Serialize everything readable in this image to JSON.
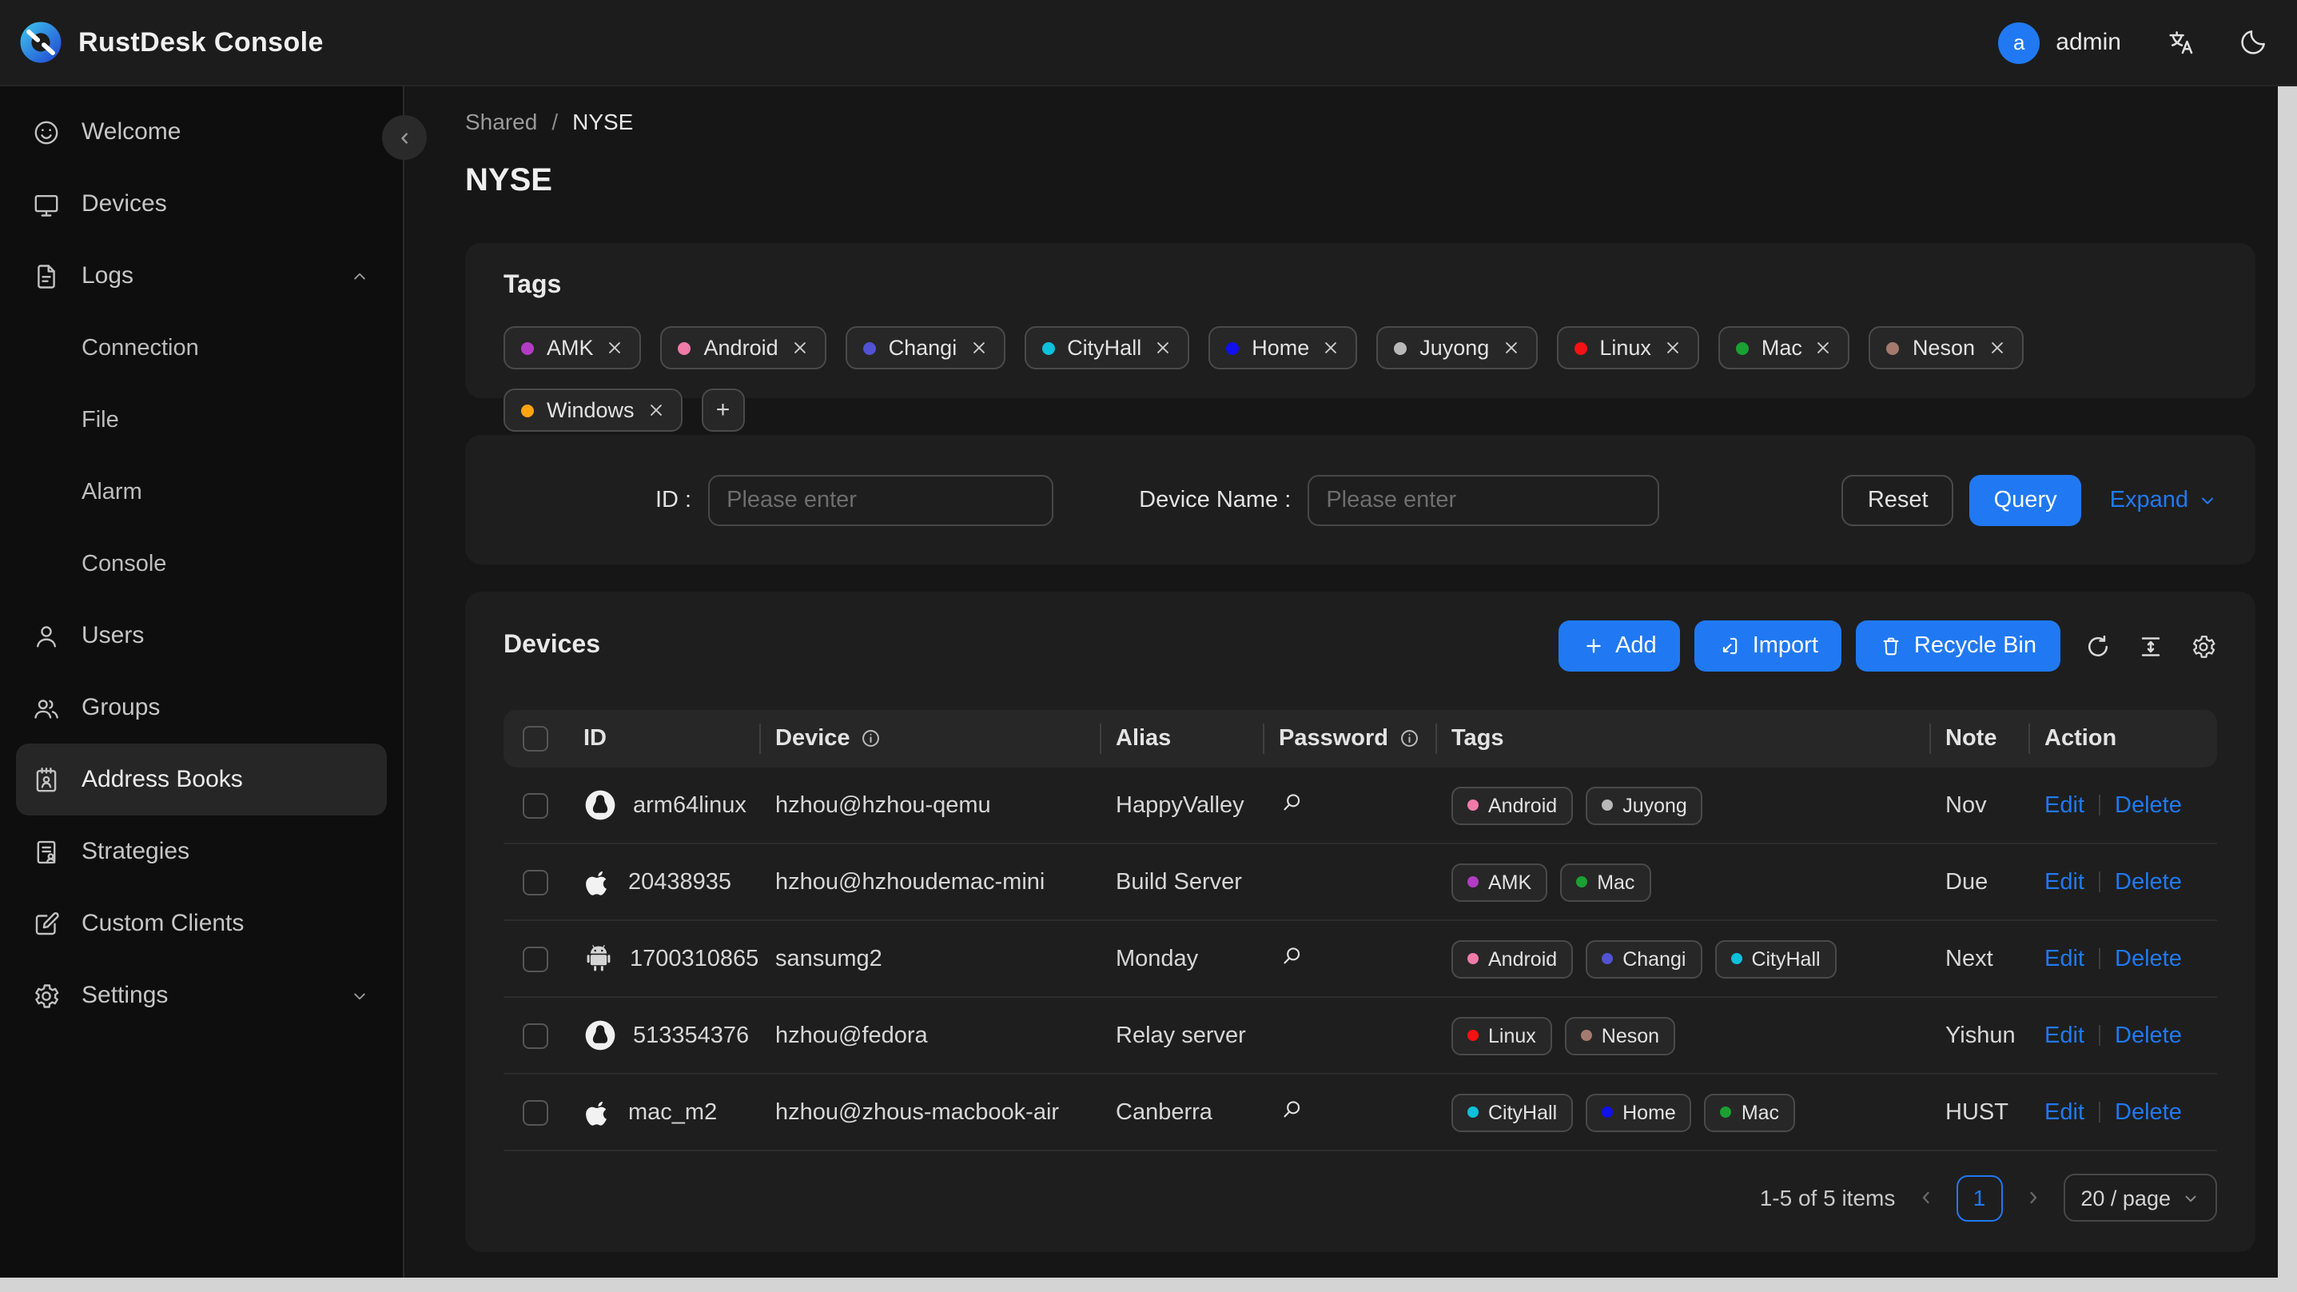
{
  "header": {
    "title": "RustDesk Console",
    "user": {
      "initial": "a",
      "name": "admin"
    }
  },
  "sidebar": {
    "items": [
      {
        "label": "Welcome",
        "icon": "smiley"
      },
      {
        "label": "Devices",
        "icon": "monitor"
      },
      {
        "label": "Logs",
        "icon": "document",
        "chevron": "up",
        "children": [
          "Connection",
          "File",
          "Alarm",
          "Console"
        ]
      },
      {
        "label": "Users",
        "icon": "user"
      },
      {
        "label": "Groups",
        "icon": "users"
      },
      {
        "label": "Address Books",
        "icon": "address-book",
        "active": true
      },
      {
        "label": "Strategies",
        "icon": "strategy"
      },
      {
        "label": "Custom Clients",
        "icon": "edit-square"
      },
      {
        "label": "Settings",
        "icon": "gear",
        "chevron": "down"
      }
    ]
  },
  "breadcrumb": {
    "parent": "Shared",
    "separator": "/",
    "current": "NYSE"
  },
  "page_title": "NYSE",
  "tags_card": {
    "title": "Tags",
    "add_button": "+",
    "tags": [
      {
        "label": "AMK",
        "color": "#b33cc4"
      },
      {
        "label": "Android",
        "color": "#f07ba8"
      },
      {
        "label": "Changi",
        "color": "#5153d4"
      },
      {
        "label": "CityHall",
        "color": "#0ec0da"
      },
      {
        "label": "Home",
        "color": "#1010f0"
      },
      {
        "label": "Juyong",
        "color": "#b8b8b8"
      },
      {
        "label": "Linux",
        "color": "#f51212"
      },
      {
        "label": "Mac",
        "color": "#1ba034"
      },
      {
        "label": "Neson",
        "color": "#a57a6e"
      },
      {
        "label": "Windows",
        "color": "#ffa313"
      }
    ]
  },
  "filter": {
    "id_label": "ID :",
    "id_placeholder": "Please enter",
    "device_name_label": "Device Name :",
    "device_name_placeholder": "Please enter",
    "reset_label": "Reset",
    "query_label": "Query",
    "expand_label": "Expand"
  },
  "devices_card": {
    "title": "Devices",
    "add_label": "Add",
    "import_label": "Import",
    "recycle_bin_label": "Recycle Bin",
    "table": {
      "columns": [
        "ID",
        "Device",
        "Alias",
        "Password",
        "Tags",
        "Note",
        "Action"
      ],
      "edit_label": "Edit",
      "delete_label": "Delete",
      "rows": [
        {
          "os": "linux",
          "id": "arm64linux",
          "device": "hzhou@hzhou-qemu",
          "alias": "HappyValley",
          "has_password": true,
          "tags": [
            "Android",
            "Juyong"
          ],
          "note": "Nov"
        },
        {
          "os": "apple",
          "id": "20438935",
          "device": "hzhou@hzhoudemac-mini",
          "alias": "Build Server",
          "has_password": false,
          "tags": [
            "AMK",
            "Mac"
          ],
          "note": "Due"
        },
        {
          "os": "android",
          "id": "1700310865",
          "device": "sansumg2",
          "alias": "Monday",
          "has_password": true,
          "tags": [
            "Android",
            "Changi",
            "CityHall"
          ],
          "note": "Next"
        },
        {
          "os": "linux",
          "id": "513354376",
          "device": "hzhou@fedora",
          "alias": "Relay server",
          "has_password": false,
          "tags": [
            "Linux",
            "Neson"
          ],
          "note": "Yishun"
        },
        {
          "os": "apple",
          "id": "mac_m2",
          "device": "hzhou@zhous-macbook-air",
          "alias": "Canberra",
          "has_password": true,
          "tags": [
            "CityHall",
            "Home",
            "Mac"
          ],
          "note": "HUST"
        }
      ]
    },
    "pagination": {
      "summary": "1-5 of 5 items",
      "current_page": "1",
      "page_size": "20 / page"
    }
  },
  "colors": {
    "accent": "#2079f2"
  }
}
